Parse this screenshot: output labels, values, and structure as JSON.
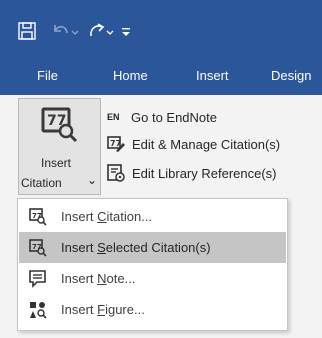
{
  "quick_access": {
    "save_icon": "floppy-disk-icon",
    "undo_icon": "undo-icon",
    "redo_icon": "redo-icon",
    "customize_icon": "customize-toolbar-icon"
  },
  "tabs": [
    {
      "label": "File"
    },
    {
      "label": "Home"
    },
    {
      "label": "Insert"
    },
    {
      "label": "Design"
    }
  ],
  "ribbon": {
    "insert_citation": {
      "line1": "Insert",
      "line2": "Citation",
      "dropdown_glyph": "⌄",
      "icon": "insert-citation-icon"
    },
    "commands": [
      {
        "badge": "EN",
        "label": "Go to EndNote",
        "icon": "endnote-icon"
      },
      {
        "label": "Edit & Manage Citation(s)",
        "icon": "edit-citation-icon"
      },
      {
        "label": "Edit Library Reference(s)",
        "icon": "edit-library-icon"
      }
    ]
  },
  "menu": {
    "items": [
      {
        "pre": "Insert ",
        "mnemonic": "C",
        "post": "itation...",
        "icon": "insert-citation-icon",
        "highlighted": false
      },
      {
        "pre": "Insert ",
        "mnemonic": "S",
        "post": "elected Citation(s)",
        "icon": "insert-selected-citation-icon",
        "highlighted": true
      },
      {
        "pre": "Insert ",
        "mnemonic": "N",
        "post": "ote...",
        "icon": "insert-note-icon",
        "highlighted": false
      },
      {
        "pre": "Insert ",
        "mnemonic": "F",
        "post": "igure...",
        "icon": "insert-figure-icon",
        "highlighted": false
      }
    ]
  },
  "colors": {
    "ribbon_blue": "#2b579a",
    "ribbon_bg": "#f3f3f3",
    "menu_hover": "#c5c5c5"
  }
}
